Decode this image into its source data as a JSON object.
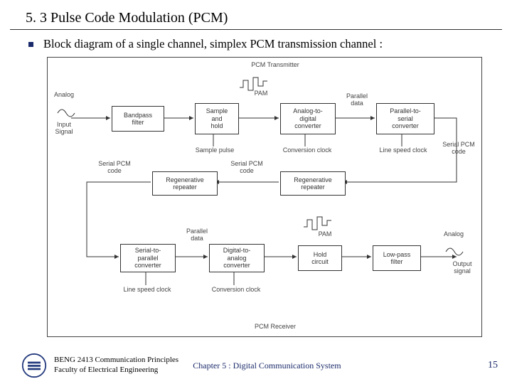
{
  "title": "5. 3 Pulse Code Modulation (PCM)",
  "bullet_text": "Block diagram of a single channel, simplex PCM transmission channel :",
  "section_top": "PCM Transmitter",
  "section_bot": "PCM Receiver",
  "labels": {
    "analog_in": "Analog",
    "input_signal": "Input\nSignal",
    "pam_top": "PAM",
    "parallel_top": "Parallel\ndata",
    "sample_pulse": "Sample pulse",
    "conv_clock_top": "Conversion clock",
    "line_clock_top": "Line speed clock",
    "serial_pcm_tx": "Serial PCM\ncode",
    "serial_pcm_mid_l": "Serial PCM\ncode",
    "serial_pcm_mid_r": "Serial PCM\ncode",
    "parallel_bot": "Parallel\ndata",
    "pam_bot": "PAM",
    "analog_out": "Analog",
    "output_signal": "Output\nsignal",
    "line_clock_bot": "Line speed clock",
    "conv_clock_bot": "Conversion clock"
  },
  "boxes": {
    "bpf": "Bandpass\nfilter",
    "sh": "Sample\nand\nhold",
    "adc": "Analog-to-\ndigital\nconverter",
    "ps": "Parallel-to-\nserial\nconverter",
    "reg1": "Regenerative\nrepeater",
    "reg2": "Regenerative\nrepeater",
    "sp": "Serial-to-\nparallel\nconverter",
    "dac": "Digital-to-\nanalog\nconverter",
    "hold": "Hold\ncircuit",
    "lpf": "Low-pass\nfilter"
  },
  "footer": {
    "line1": "BENG 2413 Communication Principles",
    "line2": "Faculty of Electrical Engineering",
    "chapter": "Chapter 5 : Digital Communication System",
    "page": "15"
  }
}
